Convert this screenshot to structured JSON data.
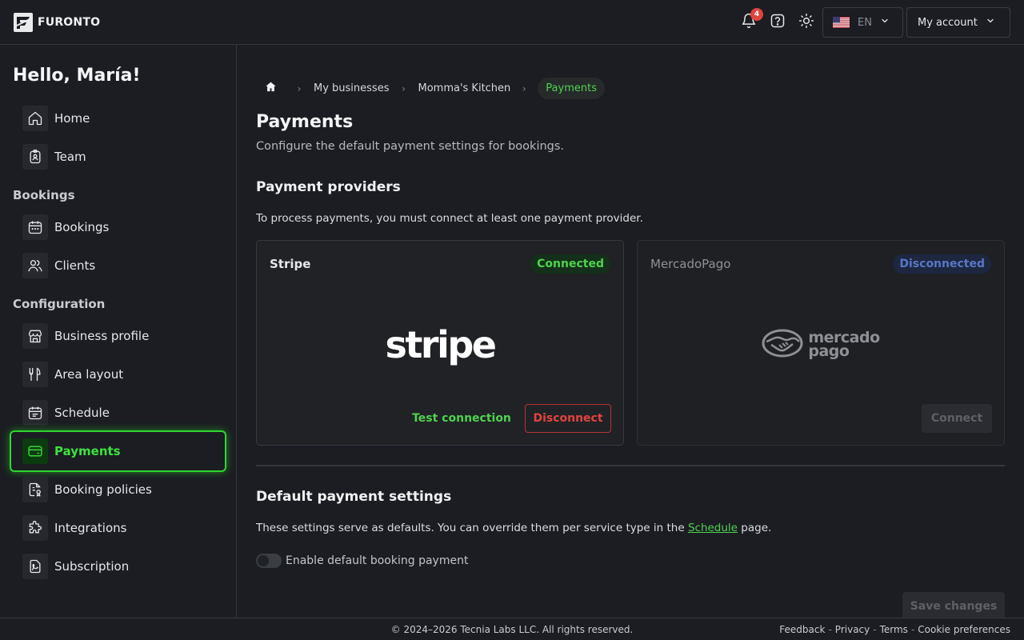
{
  "brand": {
    "name": "FURONTO"
  },
  "topbar": {
    "notifications_count": "4",
    "language": "EN",
    "account_label": "My account"
  },
  "sidebar": {
    "greeting": "Hello, María!",
    "items": [
      {
        "label": "Home",
        "icon": "home-icon"
      },
      {
        "label": "Team",
        "icon": "badge-icon"
      },
      {
        "label": "Bookings",
        "icon": "calendar-icon"
      },
      {
        "label": "Clients",
        "icon": "users-icon"
      },
      {
        "label": "Business profile",
        "icon": "store-icon"
      },
      {
        "label": "Area layout",
        "icon": "utensils-icon"
      },
      {
        "label": "Schedule",
        "icon": "calendar-clock-icon"
      },
      {
        "label": "Payments",
        "icon": "credit-card-icon",
        "active": true
      },
      {
        "label": "Booking policies",
        "icon": "file-policy-icon"
      },
      {
        "label": "Integrations",
        "icon": "puzzle-icon"
      },
      {
        "label": "Subscription",
        "icon": "signature-icon"
      }
    ],
    "sections": {
      "bookings": "Bookings",
      "configuration": "Configuration"
    }
  },
  "breadcrumb": {
    "items": [
      "My businesses",
      "Momma's Kitchen"
    ],
    "current": "Payments"
  },
  "page": {
    "title": "Payments",
    "subtitle": "Configure the default payment settings for bookings."
  },
  "providers": {
    "title": "Payment providers",
    "description": "To process payments, you must connect at least one payment provider.",
    "stripe": {
      "name": "Stripe",
      "status": "Connected",
      "logo_text": "stripe",
      "test_label": "Test connection",
      "disconnect_label": "Disconnect"
    },
    "mercadopago": {
      "name": "MercadoPago",
      "status": "Disconnected",
      "logo_text_1": "mercado",
      "logo_text_2": "pago",
      "connect_label": "Connect"
    }
  },
  "defaults": {
    "title": "Default payment settings",
    "text_before": "These settings serve as defaults. You can override them per service type in the ",
    "link": "Schedule",
    "text_after": " page.",
    "toggle_label": "Enable default booking payment",
    "toggle_on": false,
    "save_label": "Save changes"
  },
  "footer": {
    "copyright": "© 2024–2026 Tecnia Labs LLC. All rights reserved.",
    "links": [
      "Feedback",
      "Privacy",
      "Terms",
      "Cookie preferences"
    ]
  },
  "colors": {
    "accent": "#2fd62f",
    "danger": "#e0443e",
    "background": "#1b1d22"
  }
}
